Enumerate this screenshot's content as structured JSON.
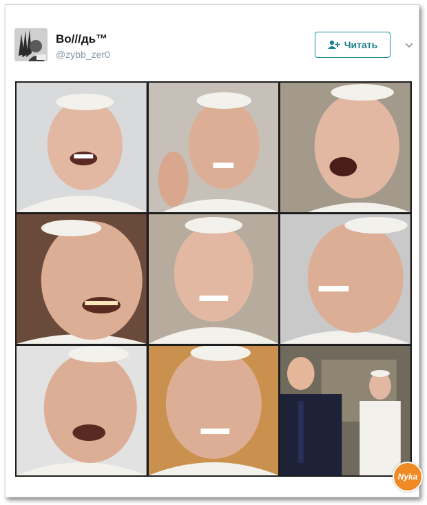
{
  "tweet": {
    "display_name": "Во///дь™",
    "handle": "@zybb_zer0",
    "follow_label": "Читать",
    "avatar_icon": "chief-headdress-avatar",
    "follow_icon": "add-user-icon",
    "menu_icon": "chevron-down-icon"
  },
  "photo_grid": {
    "rows": 3,
    "columns": 3,
    "tiles": [
      {
        "subject": "laughing-man-white-skullcap",
        "background": "#d9dadc"
      },
      {
        "subject": "smiling-man-waving",
        "background": "#c7c0b8"
      },
      {
        "subject": "surprised-laughing-man",
        "background": "#a39a8c"
      },
      {
        "subject": "grinning-man-closeup",
        "background": "#6a4a3a"
      },
      {
        "subject": "smiling-man-white-cassock",
        "background": "#b6ab9d"
      },
      {
        "subject": "laughing-man-profile",
        "background": "#c9c9c9"
      },
      {
        "subject": "wide-eyed-smiling-man",
        "background": "#e2e2e2"
      },
      {
        "subject": "winking-man",
        "background": "#c9914d"
      },
      {
        "subject": "two-men-standing-meeting",
        "background": "#6f6a5c"
      }
    ]
  },
  "watermark": {
    "label": "Nyka"
  },
  "colors": {
    "accent": "#1a8b9a",
    "name_text": "#14171a",
    "handle_text": "#8899a6",
    "grid_border": "#1d1d1d",
    "skin": "#e2b8a3",
    "cassock": "#f3f1ec"
  }
}
